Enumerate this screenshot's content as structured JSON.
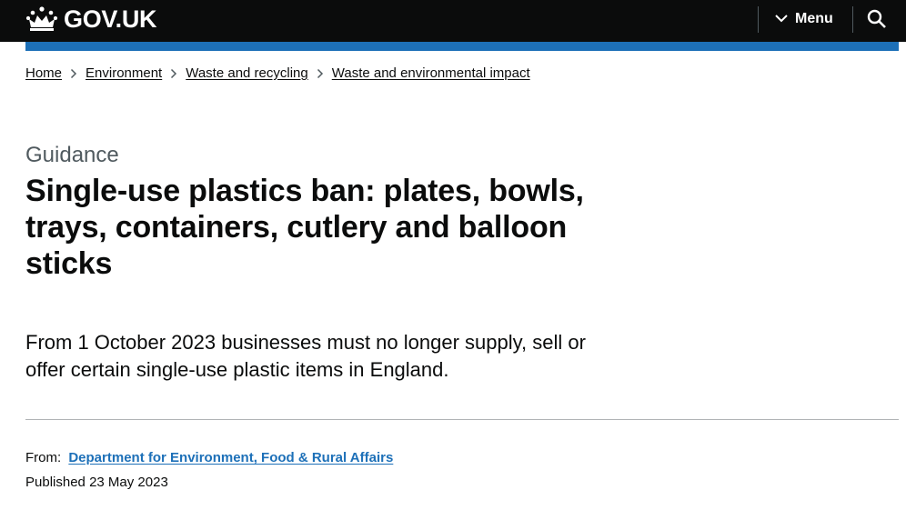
{
  "header": {
    "logo_text": "GOV.UK",
    "menu_label": "Menu",
    "search_icon": "search-icon",
    "crown_icon": "crown-icon",
    "accent_color": "#1d70b8"
  },
  "breadcrumbs": [
    {
      "label": "Home"
    },
    {
      "label": "Environment"
    },
    {
      "label": "Waste and recycling"
    },
    {
      "label": "Waste and environmental impact"
    }
  ],
  "page": {
    "caption": "Guidance",
    "title": "Single-use plastics ban: plates, bowls, trays, containers, cutlery and balloon sticks",
    "lead": "From 1 October 2023 businesses must no longer supply, sell or offer certain single-use plastic items in England."
  },
  "metadata": {
    "from_label": "From:",
    "from_org": "Department for Environment, Food & Rural Affairs",
    "published_label": "Published",
    "published_date": "23 May 2023"
  }
}
